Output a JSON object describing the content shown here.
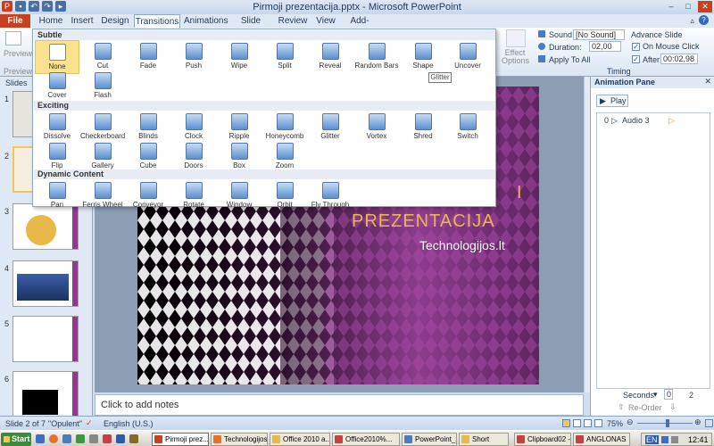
{
  "window": {
    "title": "Pirmoji prezentacija.pptx - Microsoft PowerPoint"
  },
  "tabs": [
    "File",
    "Home",
    "Insert",
    "Design",
    "Transitions",
    "Animations",
    "Slide Show",
    "Review",
    "View",
    "Add-Ins"
  ],
  "ribbon": {
    "preview": "Preview",
    "preview_group": "Preview",
    "effect_options": "Effect Options",
    "sound_label": "Sound:",
    "sound_value": "[No Sound]",
    "duration_label": "Duration:",
    "duration_value": "02,00",
    "apply_all": "Apply To All",
    "advance_slide": "Advance Slide",
    "on_mouse_click": "On Mouse Click",
    "after_label": "After:",
    "after_value": "00:02,98",
    "timing_group": "Timing"
  },
  "gallery": {
    "sections": [
      "Subtle",
      "Exciting",
      "Dynamic Content"
    ],
    "subtle": [
      "None",
      "Cut",
      "Fade",
      "Push",
      "Wipe",
      "Split",
      "Reveal",
      "Random Bars",
      "Shape",
      "Uncover",
      "Cover",
      "Flash"
    ],
    "exciting": [
      "Dissolve",
      "Checkerboard",
      "Blinds",
      "Clock",
      "Ripple",
      "Honeycomb",
      "Glitter",
      "Vortex",
      "Shred",
      "Switch",
      "Flip",
      "Gallery",
      "Cube",
      "Doors",
      "Box",
      "Zoom"
    ],
    "dynamic": [
      "Pan",
      "Ferris Wheel",
      "Conveyor",
      "Rotate",
      "Window",
      "Orbit",
      "Fly Through"
    ],
    "tooltip": "Glitter"
  },
  "slides_panel": {
    "label": "Slides",
    "numbers": [
      "1",
      "2",
      "3",
      "4",
      "5",
      "6"
    ]
  },
  "slide": {
    "title_partial": "PREZENTACIJA",
    "title_partial_right": "I",
    "subtitle": "Technologijos.lt",
    "accent": "#8c3c8c"
  },
  "notes": {
    "placeholder": "Click to add notes"
  },
  "animation_pane": {
    "title": "Animation Pane",
    "play": "Play",
    "item_index": "0",
    "item_name": "Audio 3",
    "seconds": "Seconds",
    "page": "0",
    "page2": "2",
    "reorder": "Re-Order"
  },
  "statusbar": {
    "slide": "Slide 2 of 7",
    "theme": "\"Opulent\"",
    "language": "English (U.S.)",
    "zoom": "75%"
  },
  "taskbar": {
    "start": "Start",
    "items": [
      "Pirmoji prez...",
      "Technologijos...",
      "Office 2010 a...",
      "Office2010%...",
      "PowerPoint_2...",
      "Short",
      "Clipboard02 -...",
      "ANGLONAS"
    ],
    "lang": "EN",
    "time": "12:41"
  }
}
